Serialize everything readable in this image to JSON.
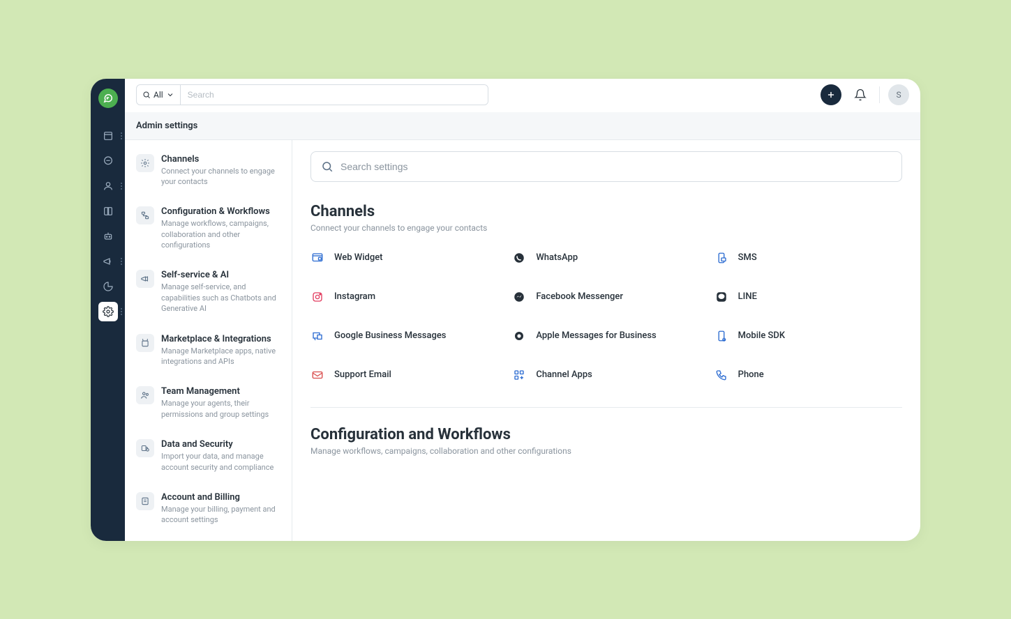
{
  "topbar": {
    "scope_label": "All",
    "search_placeholder": "Search",
    "avatar_initial": "S"
  },
  "subheader": "Admin settings",
  "sidebar": [
    {
      "title": "Channels",
      "desc": "Connect your channels to engage your contacts"
    },
    {
      "title": "Configuration & Workflows",
      "desc": "Manage workflows, campaigns, collaboration and other configurations"
    },
    {
      "title": "Self-service & AI",
      "desc": "Manage self-service, and capabilities such as Chatbots and Generative AI"
    },
    {
      "title": "Marketplace & Integrations",
      "desc": "Manage Marketplace apps, native integrations and APIs"
    },
    {
      "title": "Team Management",
      "desc": "Manage your agents, their permissions and group settings"
    },
    {
      "title": "Data and Security",
      "desc": "Import your data, and manage account security and compliance"
    },
    {
      "title": "Account and Billing",
      "desc": "Manage your billing, payment and account settings"
    }
  ],
  "settings_search_placeholder": "Search settings",
  "section1": {
    "title": "Channels",
    "sub": "Connect your channels to engage your contacts"
  },
  "channels": [
    "Web Widget",
    "WhatsApp",
    "SMS",
    "Instagram",
    "Facebook Messenger",
    "LINE",
    "Google Business Messages",
    "Apple Messages for Business",
    "Mobile SDK",
    "Support Email",
    "Channel Apps",
    "Phone"
  ],
  "section2": {
    "title": "Configuration and Workflows",
    "sub": "Manage workflows, campaigns, collaboration and other configurations"
  }
}
